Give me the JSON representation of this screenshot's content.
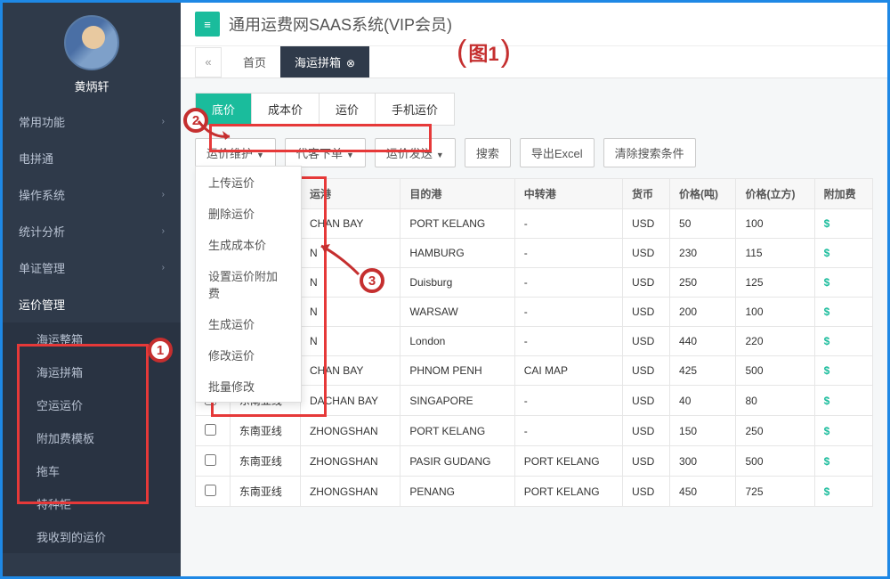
{
  "user": {
    "name": "黄炳轩"
  },
  "app_title": "通用运费网SAAS系统(VIP会员)",
  "nav": {
    "items": [
      {
        "label": "常用功能",
        "expandable": true
      },
      {
        "label": "电拼通",
        "expandable": false
      },
      {
        "label": "操作系统",
        "expandable": true
      },
      {
        "label": "统计分析",
        "expandable": true
      },
      {
        "label": "单证管理",
        "expandable": true
      },
      {
        "label": "运价管理",
        "expandable": false,
        "open": true,
        "sub": [
          {
            "label": "海运整箱"
          },
          {
            "label": "海运拼箱"
          },
          {
            "label": "空运运价"
          },
          {
            "label": "附加费模板"
          },
          {
            "label": "拖车"
          },
          {
            "label": "特种柜"
          },
          {
            "label": "我收到的运价"
          }
        ]
      }
    ]
  },
  "tabs": {
    "back_icon": "«",
    "items": [
      {
        "label": "首页"
      },
      {
        "label": "海运拼箱",
        "active": true,
        "closable": true
      }
    ]
  },
  "mode_tabs": [
    {
      "label": "底价",
      "active": true
    },
    {
      "label": "成本价"
    },
    {
      "label": "运价"
    },
    {
      "label": "手机运价"
    }
  ],
  "toolbar": {
    "rate_maint": {
      "label": "运价维护",
      "menu": [
        "上传运价",
        "删除运价",
        "生成成本价",
        "设置运价附加费",
        "生成运价",
        "修改运价",
        "批量修改"
      ]
    },
    "agent_order": {
      "label": "代客下单"
    },
    "rate_send": {
      "label": "运价发送"
    },
    "search": {
      "label": "搜索"
    },
    "export": {
      "label": "导出Excel"
    },
    "clear": {
      "label": "清除搜索条件"
    }
  },
  "table": {
    "headers": [
      "",
      "",
      "运港",
      "目的港",
      "中转港",
      "货币",
      "价格(吨)",
      "价格(立方)",
      "附加费"
    ],
    "rows": [
      {
        "route": "",
        "origin": "CHAN BAY",
        "dest": "PORT KELANG",
        "via": "-",
        "cur": "USD",
        "pt": "50",
        "pc": "100"
      },
      {
        "route": "",
        "origin": "N",
        "dest": "HAMBURG",
        "via": "-",
        "cur": "USD",
        "pt": "230",
        "pc": "115"
      },
      {
        "route": "",
        "origin": "N",
        "dest": "Duisburg",
        "via": "-",
        "cur": "USD",
        "pt": "250",
        "pc": "125"
      },
      {
        "route": "",
        "origin": "N",
        "dest": "WARSAW",
        "via": "-",
        "cur": "USD",
        "pt": "200",
        "pc": "100"
      },
      {
        "route": "",
        "origin": "N",
        "dest": "London",
        "via": "-",
        "cur": "USD",
        "pt": "440",
        "pc": "220"
      },
      {
        "route": "",
        "origin": "CHAN BAY",
        "dest": "PHNOM PENH",
        "via": "CAI MAP",
        "cur": "USD",
        "pt": "425",
        "pc": "500"
      },
      {
        "route": "东南亚线",
        "origin": "DACHAN BAY",
        "dest": "SINGAPORE",
        "via": "-",
        "cur": "USD",
        "pt": "40",
        "pc": "80"
      },
      {
        "route": "东南亚线",
        "origin": "ZHONGSHAN",
        "dest": "PORT KELANG",
        "via": "-",
        "cur": "USD",
        "pt": "150",
        "pc": "250"
      },
      {
        "route": "东南亚线",
        "origin": "ZHONGSHAN",
        "dest": "PASIR GUDANG",
        "via": "PORT KELANG",
        "cur": "USD",
        "pt": "300",
        "pc": "500"
      },
      {
        "route": "东南亚线",
        "origin": "ZHONGSHAN",
        "dest": "PENANG",
        "via": "PORT KELANG",
        "cur": "USD",
        "pt": "450",
        "pc": "725"
      }
    ],
    "surcharge_icon": "$"
  },
  "annotations": {
    "tu1": "图1",
    "n1": "1",
    "n2": "2",
    "n3": "3"
  }
}
